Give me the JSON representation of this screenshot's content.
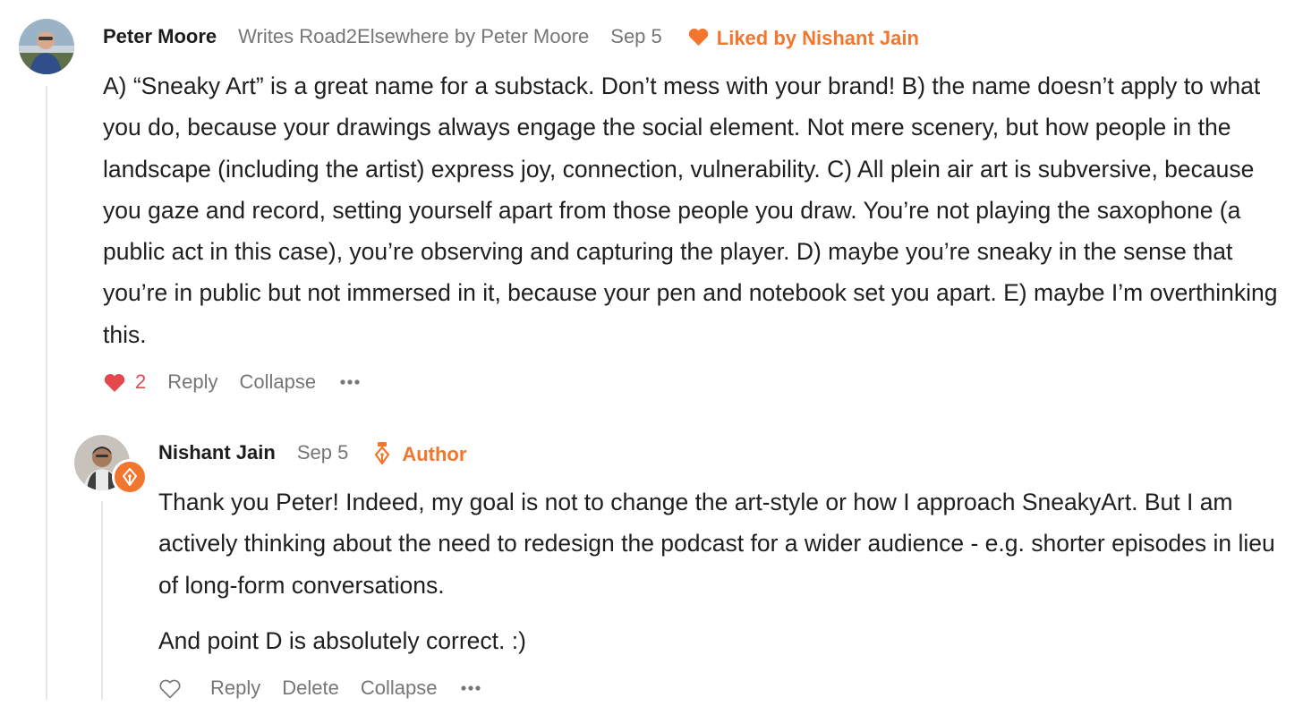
{
  "comment": {
    "author": "Peter Moore",
    "writes": "Writes Road2Elsewhere by Peter Moore",
    "date": "Sep 5",
    "liked_by": "Liked by Nishant Jain",
    "body": "A) “Sneaky Art” is a great name for a substack. Don’t mess with your brand! B) the name doesn’t apply to what you do, because your drawings always engage the social element. Not mere scenery, but how people in the landscape (including the artist) express joy, connection, vulnerability. C) All plein air art is subversive, because you gaze and record, setting yourself apart from those people you draw. You’re not playing the saxophone (a public act in this case), you’re observing and capturing the player. D) maybe you’re sneaky in the sense that you’re in public but not immersed in it, because your pen and notebook set you apart. E) maybe I’m overthinking this.",
    "like_count": "2",
    "reply_label": "Reply",
    "collapse_label": "Collapse",
    "more_icon": "ellipsis-icon",
    "like_icon": "heart-filled-icon"
  },
  "reply": {
    "author": "Nishant Jain",
    "date": "Sep 5",
    "badge": "Author",
    "badge_icon": "pen-nib-icon",
    "paragraph1": "Thank you Peter! Indeed, my goal is not to change the art-style or how I approach SneakyArt. But I am actively thinking about the need to redesign the podcast for a wider audience - e.g. shorter episodes in lieu of long-form conversations.",
    "paragraph2": "And point D is absolutely correct. :)",
    "reply_label": "Reply",
    "delete_label": "Delete",
    "collapse_label": "Collapse",
    "like_icon": "heart-outline-icon",
    "more_icon": "ellipsis-icon"
  },
  "colors": {
    "accent": "#f2762e",
    "like_red": "#e5484d",
    "meta_gray": "#767676"
  }
}
